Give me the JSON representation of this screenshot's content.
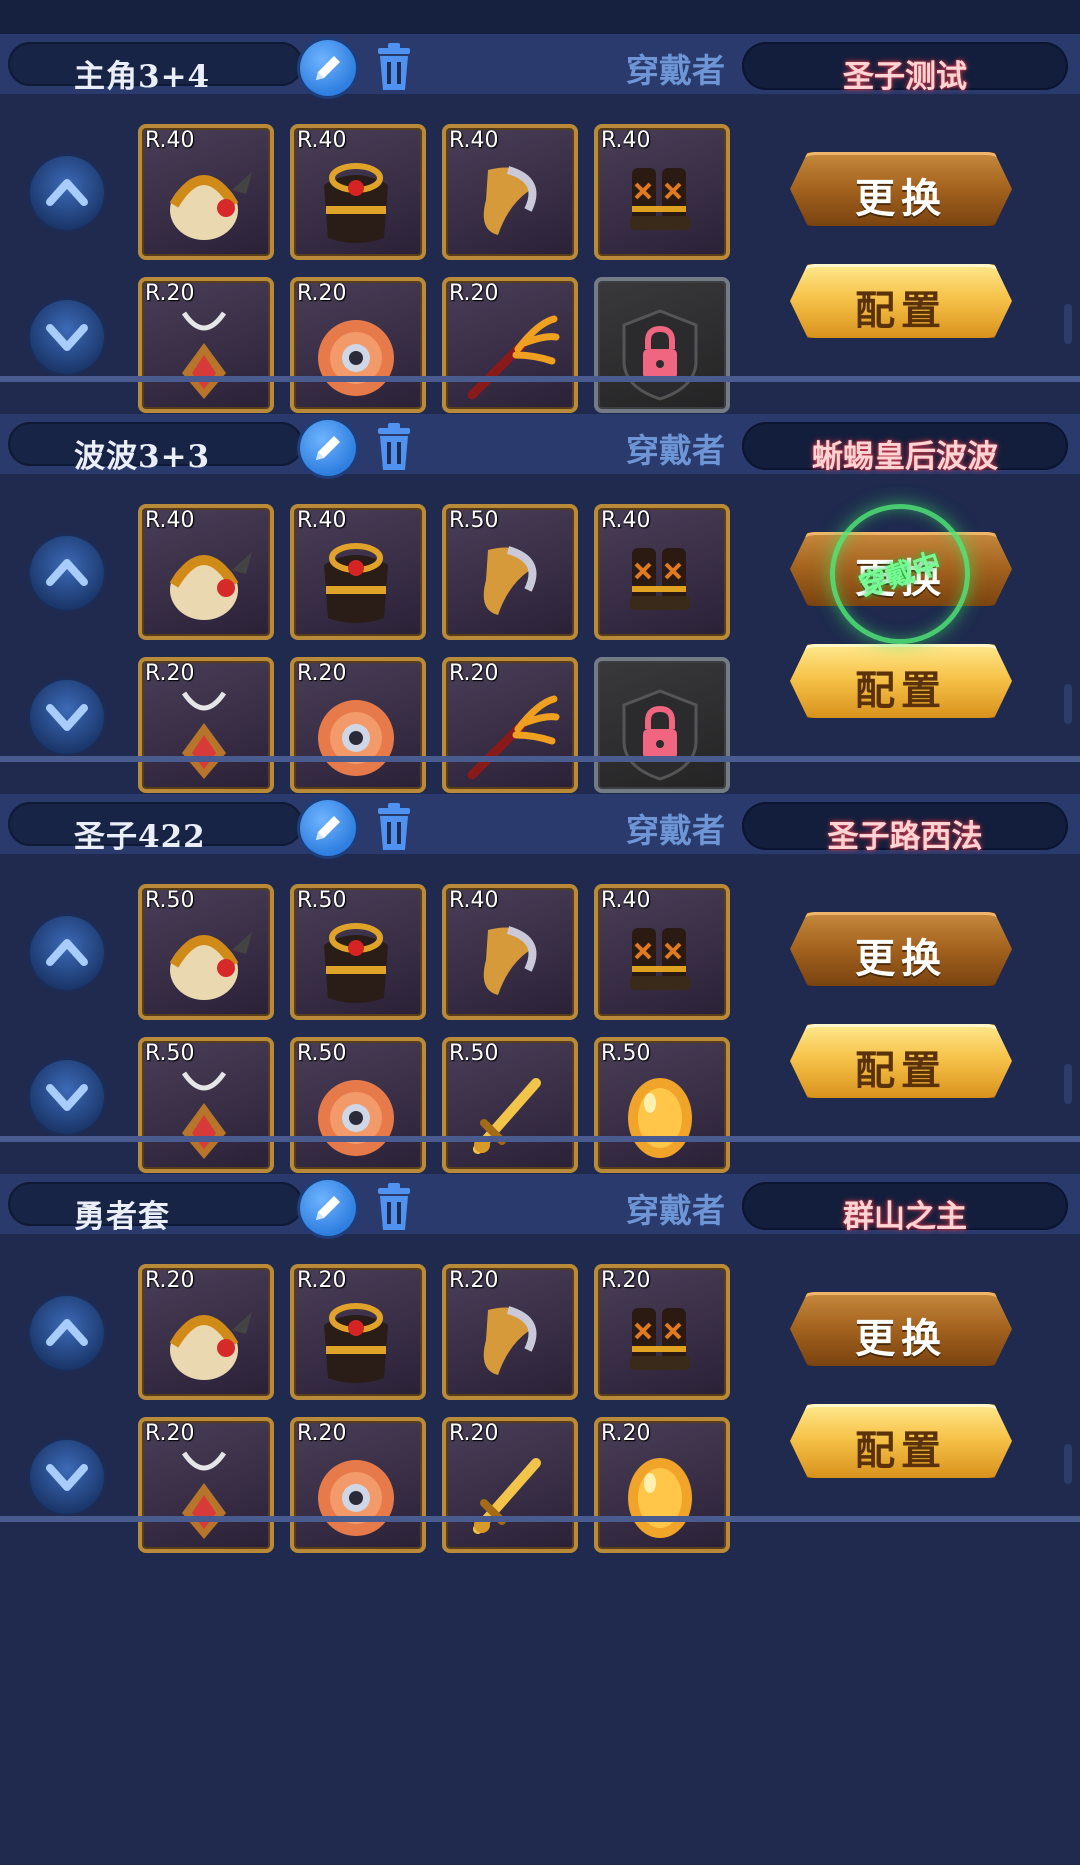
{
  "ui": {
    "wearer_label": "穿戴者",
    "swap_label": "更换",
    "config_label": "配置"
  },
  "sets": [
    {
      "name": "主角3+4",
      "wearer": "圣子测试",
      "equipped_stamp": "",
      "row1": [
        {
          "rank": "R.40",
          "icon": "helmet-icon"
        },
        {
          "rank": "R.40",
          "icon": "armor-icon"
        },
        {
          "rank": "R.40",
          "icon": "leg-guard-icon"
        },
        {
          "rank": "R.40",
          "icon": "boots-icon"
        }
      ],
      "row2": [
        {
          "rank": "R.20",
          "icon": "necklace-icon"
        },
        {
          "rank": "R.20",
          "icon": "ring-icon"
        },
        {
          "rank": "R.20",
          "icon": "trident-icon"
        },
        {
          "rank": "",
          "icon": "lock-icon"
        }
      ]
    },
    {
      "name": "波波3+3",
      "wearer": "蜥蜴皇后波波",
      "equipped_stamp": "穿戴中",
      "row1": [
        {
          "rank": "R.40",
          "icon": "helmet-icon"
        },
        {
          "rank": "R.40",
          "icon": "armor-icon"
        },
        {
          "rank": "R.50",
          "icon": "leg-guard-icon"
        },
        {
          "rank": "R.40",
          "icon": "boots-icon"
        }
      ],
      "row2": [
        {
          "rank": "R.20",
          "icon": "necklace-icon"
        },
        {
          "rank": "R.20",
          "icon": "ring-icon"
        },
        {
          "rank": "R.20",
          "icon": "trident-icon"
        },
        {
          "rank": "",
          "icon": "lock-icon"
        }
      ]
    },
    {
      "name": "圣子422",
      "wearer": "圣子路西法",
      "equipped_stamp": "",
      "row1": [
        {
          "rank": "R.50",
          "icon": "helmet-icon"
        },
        {
          "rank": "R.50",
          "icon": "armor-icon"
        },
        {
          "rank": "R.40",
          "icon": "leg-guard-icon"
        },
        {
          "rank": "R.40",
          "icon": "boots-icon"
        }
      ],
      "row2": [
        {
          "rank": "R.50",
          "icon": "necklace-icon"
        },
        {
          "rank": "R.50",
          "icon": "ring-icon"
        },
        {
          "rank": "R.50",
          "icon": "sword-icon"
        },
        {
          "rank": "R.50",
          "icon": "shield-icon"
        }
      ]
    },
    {
      "name": "勇者套",
      "wearer": "群山之主",
      "equipped_stamp": "",
      "row1": [
        {
          "rank": "R.20",
          "icon": "helmet-icon"
        },
        {
          "rank": "R.20",
          "icon": "armor-icon"
        },
        {
          "rank": "R.20",
          "icon": "leg-guard-icon"
        },
        {
          "rank": "R.20",
          "icon": "boots-icon"
        }
      ],
      "row2": [
        {
          "rank": "R.20",
          "icon": "necklace-icon"
        },
        {
          "rank": "R.20",
          "icon": "ring-icon"
        },
        {
          "rank": "R.20",
          "icon": "sword-icon"
        },
        {
          "rank": "R.20",
          "icon": "shield-icon"
        }
      ]
    }
  ]
}
